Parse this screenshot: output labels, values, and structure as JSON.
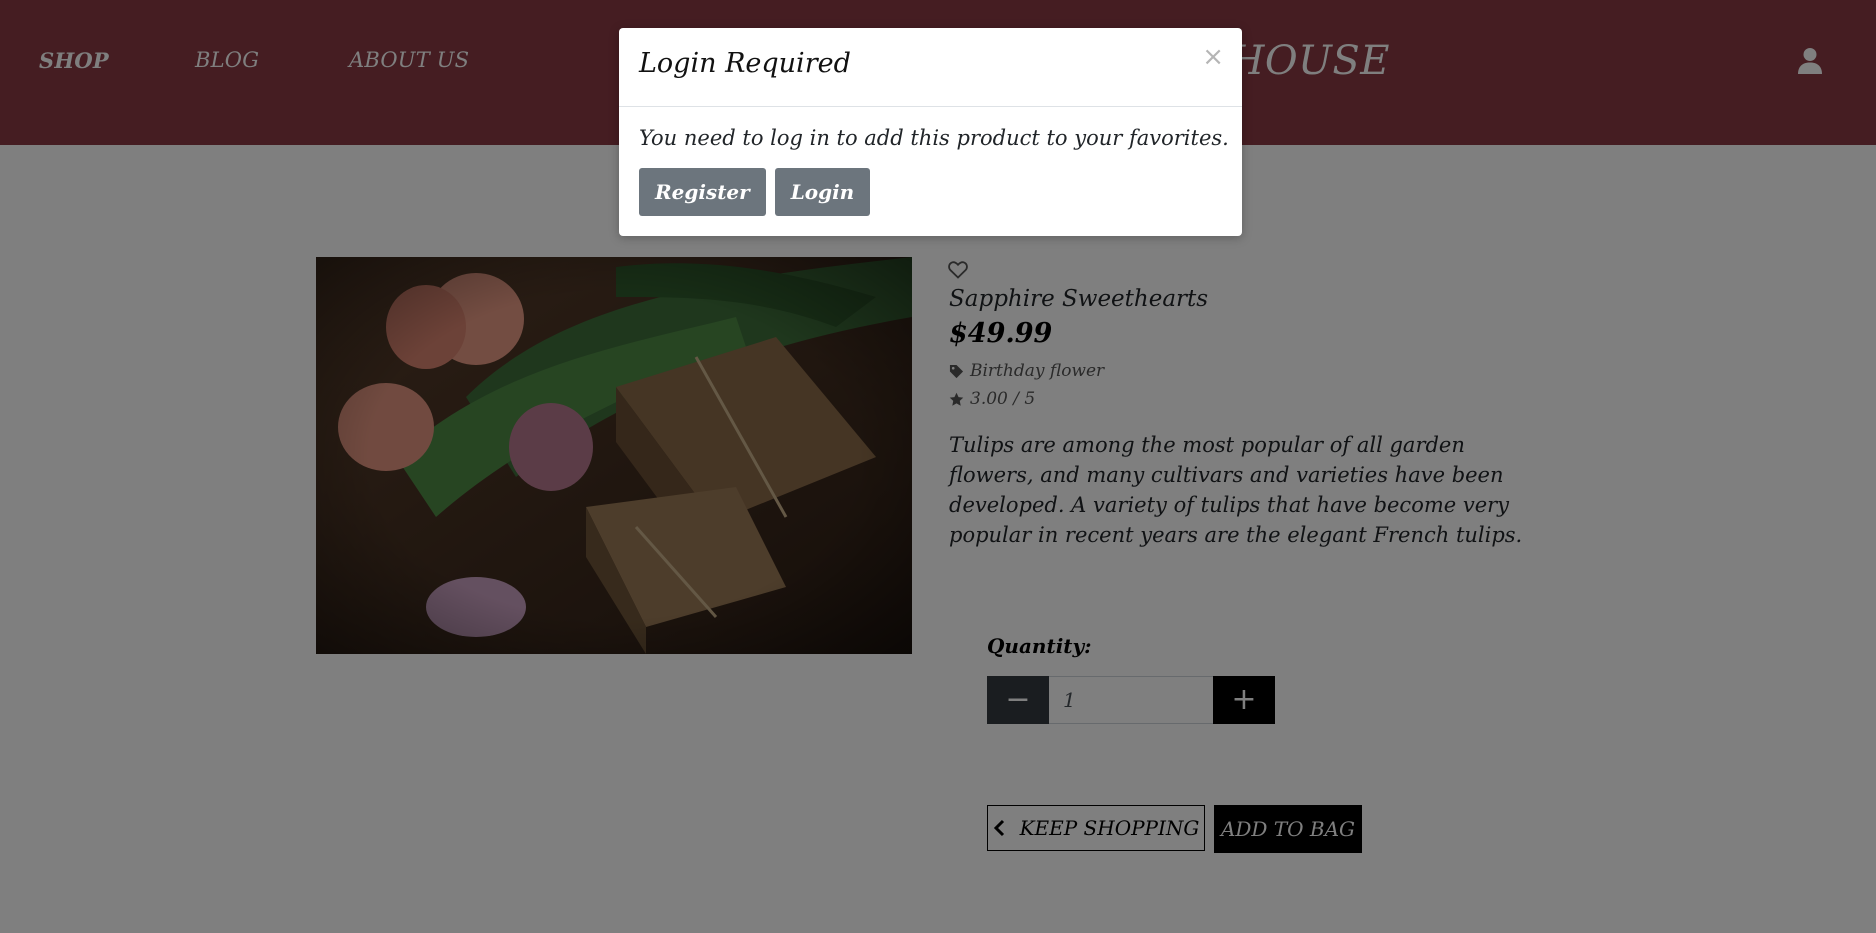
{
  "header": {
    "nav": [
      {
        "label": "SHOP",
        "active": true
      },
      {
        "label": "BLOG",
        "active": false
      },
      {
        "label": "ABOUT US",
        "active": false
      }
    ],
    "brand_visible_text": "R HOUSE",
    "user_icon": "user-icon"
  },
  "product": {
    "name": "Sapphire Sweethearts",
    "price": "$49.99",
    "category": "Birthday flower",
    "rating": "3.00 / 5",
    "description": "Tulips are among the most popular of all garden flowers, and many cultivars and varieties have been developed. A variety of tulips that have become very popular in recent years are the elegant French tulips.",
    "quantity_label": "Quantity:",
    "quantity_value": "1",
    "keep_shopping_label": "KEEP SHOPPING",
    "add_to_bag_label": "ADD TO BAG"
  },
  "modal": {
    "title": "Login Required",
    "close_symbol": "×",
    "message": "You need to log in to add this product to your favorites.",
    "register_label": "Register",
    "login_label": "Login"
  },
  "colors": {
    "header_bg": "#8a3a44",
    "button_secondary": "#6c757d",
    "qty_minus": "#343a40",
    "qty_plus": "#000000"
  }
}
